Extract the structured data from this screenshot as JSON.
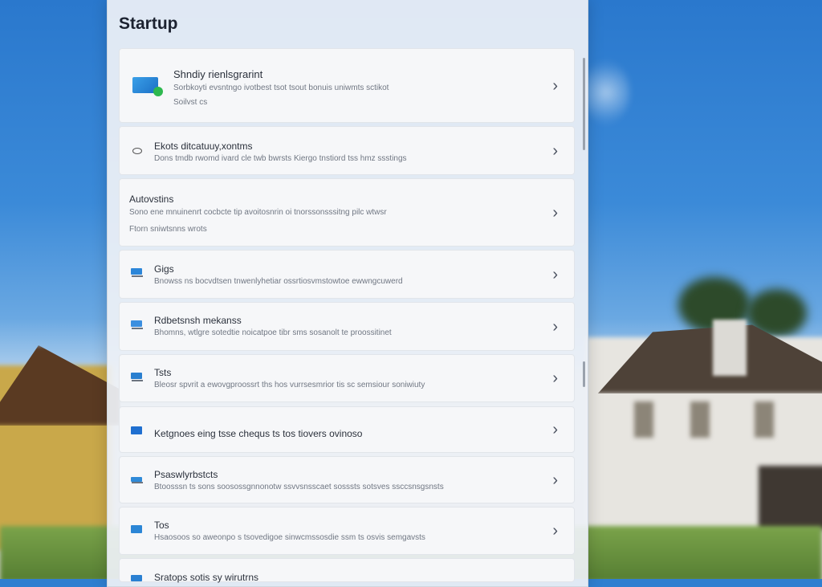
{
  "panel": {
    "title": "Startup"
  },
  "cards": [
    {
      "title": "Shndiy rienlsgrarint",
      "desc": "Sorbkoyti evsntngo ivotbest tsot tsout bonuis uniwmts sctikot",
      "desc2": "Soilvst cs",
      "icon": "monitor-app-icon"
    },
    {
      "title": "Ekots ditcatuuy,xontms",
      "desc": "Dons tmdb rwomd ivard cle twb bwrsts Kiergo tnstiord tss hmz ssstings",
      "icon": "eye-icon"
    },
    {
      "title": "Autovstins",
      "desc": "Sono ene mnuinenrt cocbcte tip avoitosnrin oi tnorssonsssitng pilc wtwsr",
      "desc2": "Ftorn sniwtsnns wrots",
      "icon": ""
    },
    {
      "title": "Gigs",
      "desc": "Bnowss ns bocvdtsen tnwenlyhetiar ossrtiosvmstowtoe ewwngcuwerd",
      "icon": "display-icon"
    },
    {
      "title": "Rdbetsnsh mekanss",
      "desc": "Bhomns, wtlgre sotedtie noicatpoe tibr sms sosanolt te proossitinet",
      "icon": "chart-icon"
    },
    {
      "title": "Tsts",
      "desc": "Bleosr spvrit a ewovgproossrt ths hos vurrsesmrior tis sc semsiour soniwiuty",
      "icon": "gallery-icon"
    },
    {
      "title": "Ketgnoes eing tsse chequs ts tos tiovers ovinoso",
      "desc": "",
      "icon": "folder-icon"
    },
    {
      "title": "Psaswlyrbstcts",
      "desc": "Btoosssn ts sons soosossgnnonotw ssvvsnsscaet sosssts sotsves ssccsnsgsnsts",
      "icon": "card-icon"
    },
    {
      "title": "Tos",
      "desc": "Hsaosoos so aweonpo s tsovedigoe sinwcmssosdie ssm ts osvis semgavsts",
      "icon": "bag-icon"
    },
    {
      "title": "Sratops sotis sy wirutrns",
      "desc": "",
      "icon": "app-icon"
    }
  ],
  "chevron": "›"
}
